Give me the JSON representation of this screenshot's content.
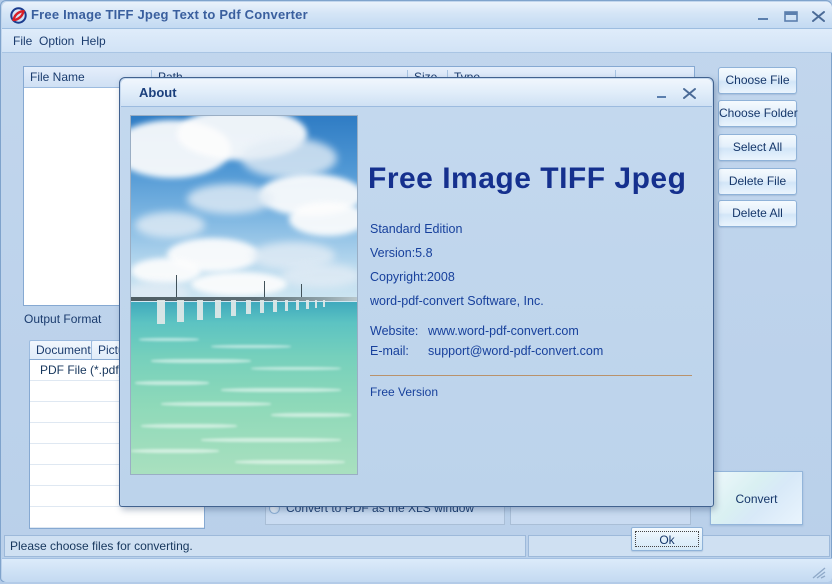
{
  "window": {
    "title": "Free Image TIFF Jpeg Text to Pdf Converter",
    "icon": "app-logo-icon",
    "controls": {
      "minimize": "–",
      "maximize": "▭",
      "close": "✕"
    }
  },
  "menu": {
    "items": [
      "File",
      "Option",
      "Help"
    ]
  },
  "file_list": {
    "columns": [
      "File Name",
      "Path",
      "Size",
      "Type",
      ""
    ],
    "rows": []
  },
  "output_format": {
    "label": "Output Format",
    "tabs": [
      "Document",
      "Picture"
    ],
    "active_tab": "Document",
    "items": [
      "PDF File  (*.pdf)",
      "",
      "",
      "",
      "",
      "",
      "",
      ""
    ]
  },
  "options": {
    "radio_label": "Convert to PDF as the XLS window",
    "radio_selected": false
  },
  "side_buttons": [
    "Choose File",
    "Choose Folder",
    "Select All",
    "Delete File",
    "Delete All"
  ],
  "convert_button": {
    "label": "Convert"
  },
  "status_bar": {
    "message": "Please choose files for converting."
  },
  "about_dialog": {
    "title": "About",
    "controls": {
      "minimize": "–",
      "close": "✕"
    },
    "photo_alt": "tropical-bridge-over-turquoise-sea-photo",
    "product_name": "Free Image TIFF Jpeg",
    "lines": [
      "Standard Edition",
      "Version:5.8",
      "Copyright:2008",
      "word-pdf-convert Software, Inc."
    ],
    "website_label": "Website:",
    "website_value": "www.word-pdf-convert.com",
    "email_label": "E-mail:",
    "email_value": "support@word-pdf-convert.com",
    "edition_note": "Free Version",
    "ok_label": "Ok"
  },
  "colors": {
    "title_text": "#3a5f9e",
    "dialog_text": "#17409c",
    "heading": "#15308e",
    "window_bg": "#bed4ec",
    "divider": "#b9926c"
  }
}
